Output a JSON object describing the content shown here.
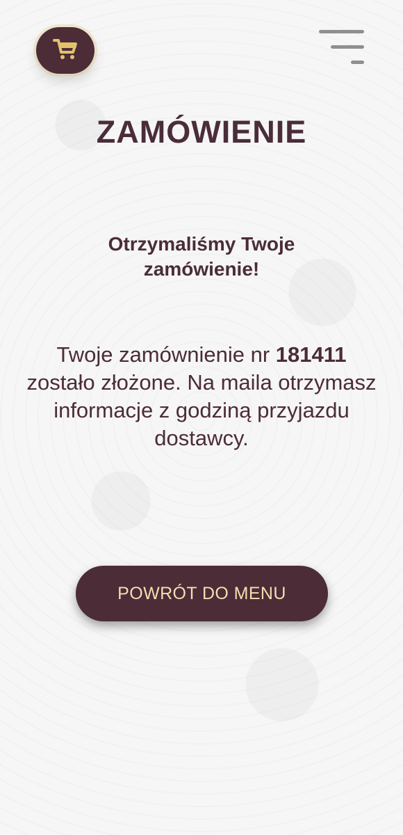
{
  "header": {
    "cart_icon": "shopping-cart-icon",
    "menu_icon": "hamburger-menu-icon"
  },
  "page": {
    "title": "ZAMÓWIENIE",
    "subtitle": "Otrzymaliśmy Twoje zamówienie!",
    "message_before_number": "Twoje zamównienie nr ",
    "order_number": "181411",
    "message_after_number": " zostało złożone. Na maila otrzymasz informacje z godziną przyjazdu dostawcy."
  },
  "actions": {
    "back_to_menu_label": "POWRÓT DO MENU"
  },
  "colors": {
    "primary": "#4b2c37",
    "accent": "#e2c26c",
    "menu_icon": "#8f8f8f",
    "button_text": "#f3dfb1"
  }
}
